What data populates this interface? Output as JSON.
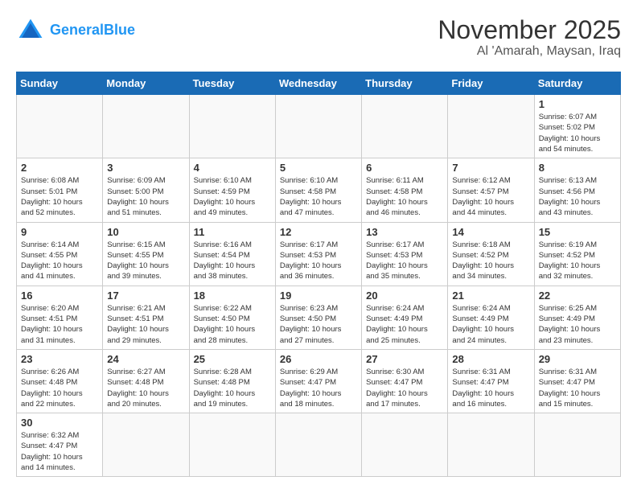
{
  "header": {
    "logo_general": "General",
    "logo_blue": "Blue",
    "title": "November 2025",
    "subtitle": "Al 'Amarah, Maysan, Iraq"
  },
  "weekdays": [
    "Sunday",
    "Monday",
    "Tuesday",
    "Wednesday",
    "Thursday",
    "Friday",
    "Saturday"
  ],
  "days": [
    {
      "date": 1,
      "sunrise": "6:07 AM",
      "sunset": "5:02 PM",
      "daylight_hours": 10,
      "daylight_minutes": 54
    },
    {
      "date": 2,
      "sunrise": "6:08 AM",
      "sunset": "5:01 PM",
      "daylight_hours": 10,
      "daylight_minutes": 52
    },
    {
      "date": 3,
      "sunrise": "6:09 AM",
      "sunset": "5:00 PM",
      "daylight_hours": 10,
      "daylight_minutes": 51
    },
    {
      "date": 4,
      "sunrise": "6:10 AM",
      "sunset": "4:59 PM",
      "daylight_hours": 10,
      "daylight_minutes": 49
    },
    {
      "date": 5,
      "sunrise": "6:10 AM",
      "sunset": "4:58 PM",
      "daylight_hours": 10,
      "daylight_minutes": 47
    },
    {
      "date": 6,
      "sunrise": "6:11 AM",
      "sunset": "4:58 PM",
      "daylight_hours": 10,
      "daylight_minutes": 46
    },
    {
      "date": 7,
      "sunrise": "6:12 AM",
      "sunset": "4:57 PM",
      "daylight_hours": 10,
      "daylight_minutes": 44
    },
    {
      "date": 8,
      "sunrise": "6:13 AM",
      "sunset": "4:56 PM",
      "daylight_hours": 10,
      "daylight_minutes": 43
    },
    {
      "date": 9,
      "sunrise": "6:14 AM",
      "sunset": "4:55 PM",
      "daylight_hours": 10,
      "daylight_minutes": 41
    },
    {
      "date": 10,
      "sunrise": "6:15 AM",
      "sunset": "4:55 PM",
      "daylight_hours": 10,
      "daylight_minutes": 39
    },
    {
      "date": 11,
      "sunrise": "6:16 AM",
      "sunset": "4:54 PM",
      "daylight_hours": 10,
      "daylight_minutes": 38
    },
    {
      "date": 12,
      "sunrise": "6:17 AM",
      "sunset": "4:53 PM",
      "daylight_hours": 10,
      "daylight_minutes": 36
    },
    {
      "date": 13,
      "sunrise": "6:17 AM",
      "sunset": "4:53 PM",
      "daylight_hours": 10,
      "daylight_minutes": 35
    },
    {
      "date": 14,
      "sunrise": "6:18 AM",
      "sunset": "4:52 PM",
      "daylight_hours": 10,
      "daylight_minutes": 34
    },
    {
      "date": 15,
      "sunrise": "6:19 AM",
      "sunset": "4:52 PM",
      "daylight_hours": 10,
      "daylight_minutes": 32
    },
    {
      "date": 16,
      "sunrise": "6:20 AM",
      "sunset": "4:51 PM",
      "daylight_hours": 10,
      "daylight_minutes": 31
    },
    {
      "date": 17,
      "sunrise": "6:21 AM",
      "sunset": "4:51 PM",
      "daylight_hours": 10,
      "daylight_minutes": 29
    },
    {
      "date": 18,
      "sunrise": "6:22 AM",
      "sunset": "4:50 PM",
      "daylight_hours": 10,
      "daylight_minutes": 28
    },
    {
      "date": 19,
      "sunrise": "6:23 AM",
      "sunset": "4:50 PM",
      "daylight_hours": 10,
      "daylight_minutes": 27
    },
    {
      "date": 20,
      "sunrise": "6:24 AM",
      "sunset": "4:49 PM",
      "daylight_hours": 10,
      "daylight_minutes": 25
    },
    {
      "date": 21,
      "sunrise": "6:24 AM",
      "sunset": "4:49 PM",
      "daylight_hours": 10,
      "daylight_minutes": 24
    },
    {
      "date": 22,
      "sunrise": "6:25 AM",
      "sunset": "4:49 PM",
      "daylight_hours": 10,
      "daylight_minutes": 23
    },
    {
      "date": 23,
      "sunrise": "6:26 AM",
      "sunset": "4:48 PM",
      "daylight_hours": 10,
      "daylight_minutes": 22
    },
    {
      "date": 24,
      "sunrise": "6:27 AM",
      "sunset": "4:48 PM",
      "daylight_hours": 10,
      "daylight_minutes": 20
    },
    {
      "date": 25,
      "sunrise": "6:28 AM",
      "sunset": "4:48 PM",
      "daylight_hours": 10,
      "daylight_minutes": 19
    },
    {
      "date": 26,
      "sunrise": "6:29 AM",
      "sunset": "4:47 PM",
      "daylight_hours": 10,
      "daylight_minutes": 18
    },
    {
      "date": 27,
      "sunrise": "6:30 AM",
      "sunset": "4:47 PM",
      "daylight_hours": 10,
      "daylight_minutes": 17
    },
    {
      "date": 28,
      "sunrise": "6:31 AM",
      "sunset": "4:47 PM",
      "daylight_hours": 10,
      "daylight_minutes": 16
    },
    {
      "date": 29,
      "sunrise": "6:31 AM",
      "sunset": "4:47 PM",
      "daylight_hours": 10,
      "daylight_minutes": 15
    },
    {
      "date": 30,
      "sunrise": "6:32 AM",
      "sunset": "4:47 PM",
      "daylight_hours": 10,
      "daylight_minutes": 14
    }
  ]
}
